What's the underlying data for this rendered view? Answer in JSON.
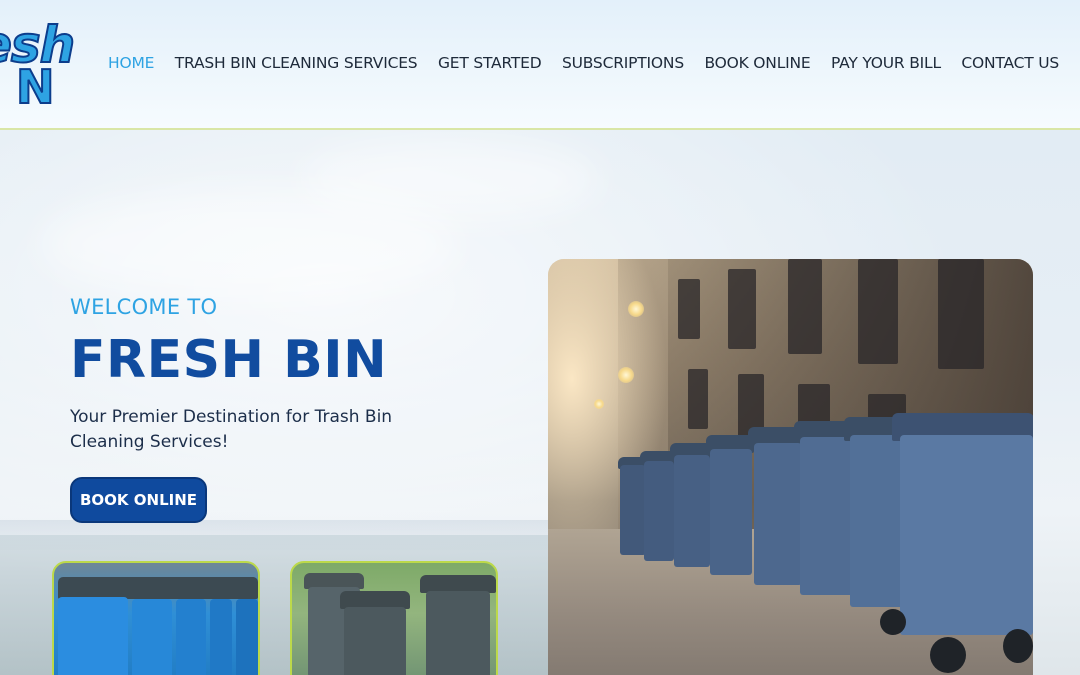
{
  "header": {
    "logo": {
      "line1": "esh",
      "line2": "N"
    },
    "nav": [
      {
        "label": "HOME",
        "active": true
      },
      {
        "label": "TRASH BIN CLEANING SERVICES",
        "active": false
      },
      {
        "label": "GET STARTED",
        "active": false
      },
      {
        "label": "SUBSCRIPTIONS",
        "active": false
      },
      {
        "label": "BOOK ONLINE",
        "active": false
      },
      {
        "label": "PAY YOUR BILL",
        "active": false
      },
      {
        "label": "CONTACT US",
        "active": false
      }
    ]
  },
  "hero": {
    "welcome": "WELCOME TO",
    "title": "FRESH BIN",
    "subtitle": "Your Premier Destination for Trash Bin Cleaning Services!",
    "cta_label": "BOOK ONLINE"
  },
  "colors": {
    "accent": "#2ea3e3",
    "brand_dark": "#114c9f",
    "button": "#0f4a9e",
    "thumb_border": "#bcd94a"
  }
}
